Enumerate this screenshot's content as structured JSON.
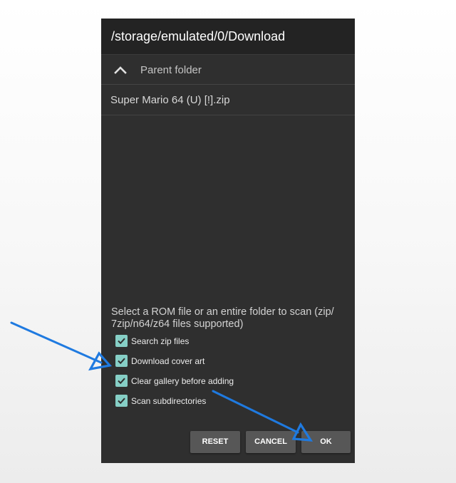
{
  "dialog": {
    "title": "/storage/emulated/0/Download",
    "parent_folder_label": "Parent folder",
    "files": [
      "Super Mario 64 (U) [!].zip"
    ],
    "message": "Select a ROM file or an entire folder to scan (zip/ 7zip/n64/z64 files supported)",
    "options": [
      {
        "label": "Search zip files",
        "checked": true
      },
      {
        "label": "Download cover art",
        "checked": true
      },
      {
        "label": "Clear gallery before adding",
        "checked": true
      },
      {
        "label": "Scan subdirectories",
        "checked": true
      }
    ],
    "buttons": {
      "reset": "RESET",
      "cancel": "CANCEL",
      "ok": "OK"
    }
  },
  "colors": {
    "dialog_background": "#2f2f2f",
    "title_background": "#232323",
    "checkbox_accent": "#86cfc6",
    "button_background": "#575757",
    "annotation_arrow": "#1f7ae0"
  },
  "icons": {
    "parent_folder": "chevron-up-icon",
    "checkbox": "checkmark-icon"
  }
}
